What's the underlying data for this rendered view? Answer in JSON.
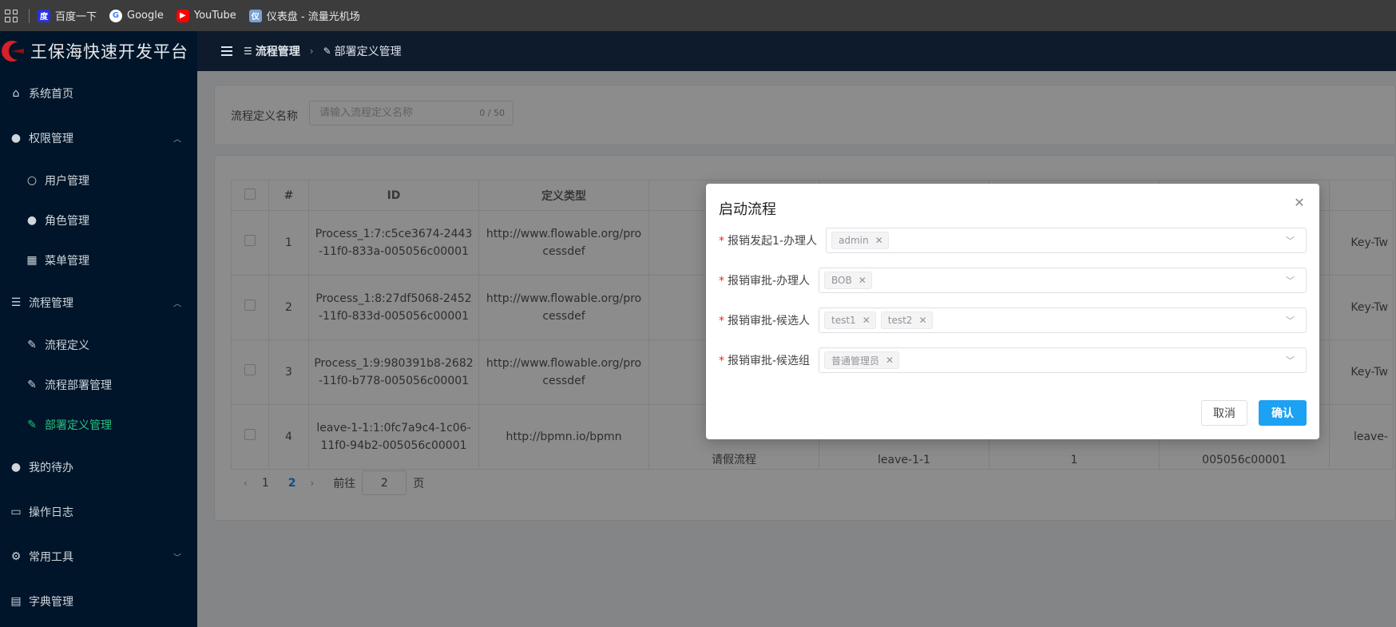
{
  "bookmarks": [
    {
      "label": "百度一下",
      "icon": "baidu-icon",
      "color": "#2932e1"
    },
    {
      "label": "Google",
      "icon": "google-icon",
      "color": "#ffffff"
    },
    {
      "label": "YouTube",
      "icon": "youtube-icon",
      "color": "#ff0000"
    },
    {
      "label": "仪表盘 - 流量光机场",
      "icon": "dashboard-icon",
      "color": "#7aa0d6"
    }
  ],
  "sidebar": {
    "title": "王保海快速开发平台",
    "items": [
      {
        "label": "系统首页",
        "icon": "home-icon"
      },
      {
        "label": "权限管理",
        "icon": "user-icon"
      },
      {
        "label": "用户管理",
        "icon": "user-outline-icon"
      },
      {
        "label": "角色管理",
        "icon": "role-icon"
      },
      {
        "label": "菜单管理",
        "icon": "menu-grid-icon"
      },
      {
        "label": "流程管理",
        "icon": "sliders-icon"
      },
      {
        "label": "流程定义",
        "icon": "edit-icon"
      },
      {
        "label": "流程部署管理",
        "icon": "edit-icon"
      },
      {
        "label": "部署定义管理",
        "icon": "edit-icon"
      },
      {
        "label": "我的待办",
        "icon": "user-icon"
      },
      {
        "label": "操作日志",
        "icon": "chat-icon"
      },
      {
        "label": "常用工具",
        "icon": "gear-icon"
      },
      {
        "label": "字典管理",
        "icon": "clipboard-icon"
      }
    ],
    "active_color": "#26c281"
  },
  "header": {
    "breadcrumb": [
      "流程管理",
      "部署定义管理"
    ]
  },
  "search": {
    "label": "流程定义名称",
    "placeholder": "请输入流程定义名称",
    "count": "0 / 50"
  },
  "table": {
    "columns": [
      "#",
      "ID",
      "定义类型"
    ],
    "rows": [
      {
        "index": "1",
        "id": "Process_1:7:c5ce3674-2443-11f0-833a-005056c00001",
        "type": "http://www.flowable.org/processdef",
        "right": "Key-Tw"
      },
      {
        "index": "2",
        "id": "Process_1:8:27df5068-2452-11f0-833d-005056c00001",
        "type": "http://www.flowable.org/processdef",
        "right": "Key-Tw"
      },
      {
        "index": "3",
        "id": "Process_1:9:980391b8-2682-11f0-b778-005056c00001",
        "type": "http://www.flowable.org/processdef",
        "right": "Key-Tw"
      },
      {
        "index": "4",
        "id": "leave-1-1:1:0fc7a9c4-1c06-11f0-94b2-005056c00001",
        "type": "http://bpmn.io/bpmn",
        "right": "leave-",
        "col_name": "请假流程",
        "col_key": "leave-1-1",
        "col_ver": "1",
        "col_dep": "005056c00001"
      }
    ]
  },
  "pagination": {
    "pages": [
      "1",
      "2"
    ],
    "current": "2",
    "goto_label": "前往",
    "goto_value": "2",
    "page_label": "页"
  },
  "dialog": {
    "title": "启动流程",
    "fields": [
      {
        "label": "报销发起1-办理人",
        "tags": [
          "admin"
        ]
      },
      {
        "label": "报销审批-办理人",
        "tags": [
          "BOB"
        ]
      },
      {
        "label": "报销审批-候选人",
        "tags": [
          "test1",
          "test2"
        ]
      },
      {
        "label": "报销审批-候选组",
        "tags": [
          "普通管理员"
        ]
      }
    ],
    "cancel_label": "取消",
    "confirm_label": "确认",
    "confirm_color": "#1da1f2"
  }
}
